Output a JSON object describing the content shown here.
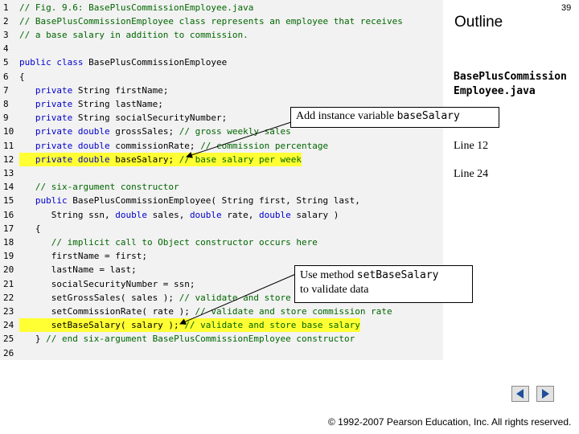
{
  "slide": {
    "outline_title": "Outline",
    "slide_number": "39",
    "filename_line1": "BasePlusCommission",
    "filename_line2": "Employee.java",
    "line_refs": [
      "Line 12",
      "Line 24"
    ],
    "callout1": {
      "text": "Add instance variable ",
      "code": "baseSalary"
    },
    "callout2": {
      "text": "Use method ",
      "code": "setBaseSalary",
      "text2": "to validate data"
    },
    "copyright": "© 1992-2007 Pearson Education, Inc.  All rights reserved."
  },
  "code_lines": [
    {
      "n": "1",
      "segs": [
        {
          "c": "cm",
          "t": "// Fig. 9.6: BasePlusCommissionEmployee.java"
        }
      ]
    },
    {
      "n": "2",
      "segs": [
        {
          "c": "cm",
          "t": "// BasePlusCommissionEmployee class represents an employee that receives"
        }
      ]
    },
    {
      "n": "3",
      "segs": [
        {
          "c": "cm",
          "t": "// a base salary in addition to commission."
        }
      ]
    },
    {
      "n": "4",
      "segs": []
    },
    {
      "n": "5",
      "segs": [
        {
          "c": "kw",
          "t": "public class "
        },
        {
          "c": "tx",
          "t": "BasePlusCommissionEmployee"
        }
      ]
    },
    {
      "n": "6",
      "segs": [
        {
          "c": "tx",
          "t": "{"
        }
      ]
    },
    {
      "n": "7",
      "segs": [
        {
          "c": "kw",
          "t": "   private "
        },
        {
          "c": "tx",
          "t": "String firstName;"
        }
      ]
    },
    {
      "n": "8",
      "segs": [
        {
          "c": "kw",
          "t": "   private "
        },
        {
          "c": "tx",
          "t": "String lastName;"
        }
      ]
    },
    {
      "n": "9",
      "segs": [
        {
          "c": "kw",
          "t": "   private "
        },
        {
          "c": "tx",
          "t": "String socialSecurityNumber;"
        }
      ]
    },
    {
      "n": "10",
      "segs": [
        {
          "c": "kw",
          "t": "   private double "
        },
        {
          "c": "tx",
          "t": "grossSales; "
        },
        {
          "c": "cm",
          "t": "// gross weekly sales"
        }
      ]
    },
    {
      "n": "11",
      "segs": [
        {
          "c": "kw",
          "t": "   private double "
        },
        {
          "c": "tx",
          "t": "commissionRate; "
        },
        {
          "c": "cm",
          "t": "// commission percentage"
        }
      ]
    },
    {
      "n": "12",
      "hl": true,
      "segs": [
        {
          "c": "kw",
          "t": "   private double "
        },
        {
          "c": "tx",
          "t": "baseSalary; "
        },
        {
          "c": "cm",
          "t": "// base salary per week"
        }
      ]
    },
    {
      "n": "13",
      "segs": []
    },
    {
      "n": "14",
      "segs": [
        {
          "c": "cm",
          "t": "   // six-argument constructor"
        }
      ]
    },
    {
      "n": "15",
      "segs": [
        {
          "c": "kw",
          "t": "   public "
        },
        {
          "c": "tx",
          "t": "BasePlusCommissionEmployee( String first, String last,"
        }
      ]
    },
    {
      "n": "16",
      "segs": [
        {
          "c": "tx",
          "t": "      String ssn, "
        },
        {
          "c": "kw",
          "t": "double "
        },
        {
          "c": "tx",
          "t": "sales, "
        },
        {
          "c": "kw",
          "t": "double "
        },
        {
          "c": "tx",
          "t": "rate, "
        },
        {
          "c": "kw",
          "t": "double "
        },
        {
          "c": "tx",
          "t": "salary )"
        }
      ]
    },
    {
      "n": "17",
      "segs": [
        {
          "c": "tx",
          "t": "   {"
        }
      ]
    },
    {
      "n": "18",
      "segs": [
        {
          "c": "cm",
          "t": "      // implicit call to Object constructor occurs here"
        }
      ]
    },
    {
      "n": "19",
      "segs": [
        {
          "c": "tx",
          "t": "      firstName = first;"
        }
      ]
    },
    {
      "n": "20",
      "segs": [
        {
          "c": "tx",
          "t": "      lastName = last;"
        }
      ]
    },
    {
      "n": "21",
      "segs": [
        {
          "c": "tx",
          "t": "      socialSecurityNumber = ssn;"
        }
      ]
    },
    {
      "n": "22",
      "segs": [
        {
          "c": "tx",
          "t": "      setGrossSales( sales ); "
        },
        {
          "c": "cm",
          "t": "// validate and store gross sales"
        }
      ]
    },
    {
      "n": "23",
      "segs": [
        {
          "c": "tx",
          "t": "      setCommissionRate( rate ); "
        },
        {
          "c": "cm",
          "t": "// validate and store commission rate"
        }
      ]
    },
    {
      "n": "24",
      "hl": true,
      "segs": [
        {
          "c": "tx",
          "t": "      setBaseSalary( salary ); "
        },
        {
          "c": "cm",
          "t": "// validate and store base salary"
        }
      ]
    },
    {
      "n": "25",
      "segs": [
        {
          "c": "tx",
          "t": "   } "
        },
        {
          "c": "cm",
          "t": "// end six-argument BasePlusCommissionEmployee constructor"
        }
      ]
    },
    {
      "n": "26",
      "segs": []
    }
  ]
}
